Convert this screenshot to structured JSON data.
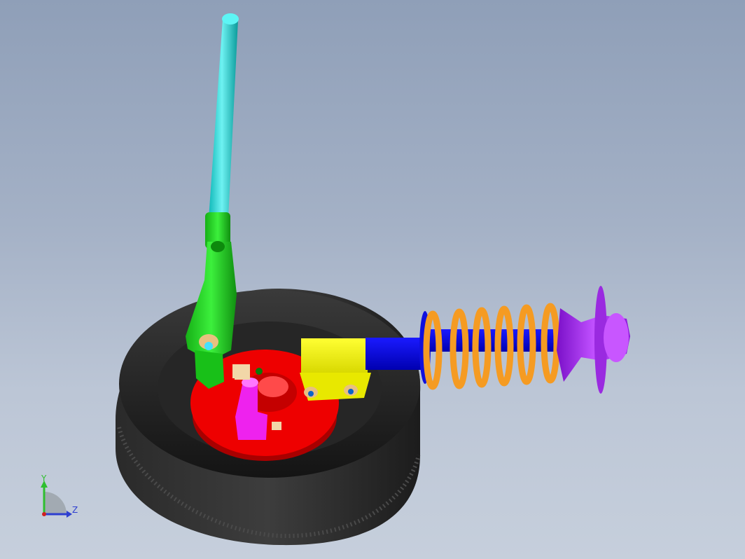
{
  "scene": {
    "background_top": "#8f9fb8",
    "background_bottom": "#c6cfdc",
    "parts": [
      {
        "name": "tire",
        "color": "#2a2a2a"
      },
      {
        "name": "brake-disc",
        "color": "#ee0000"
      },
      {
        "name": "steering-rod",
        "color": "#18d6d6"
      },
      {
        "name": "steering-knuckle",
        "color": "#1fd11f"
      },
      {
        "name": "strut-clamp",
        "color": "#f2f200"
      },
      {
        "name": "damper",
        "color": "#0000ee"
      },
      {
        "name": "coil-spring",
        "color": "#f59b22"
      },
      {
        "name": "top-mount",
        "color": "#a020f0"
      },
      {
        "name": "tie-rod-end",
        "color": "#ee22ee"
      }
    ]
  },
  "triad": {
    "y_label": "Y",
    "z_label": "Z",
    "y_color": "#2fbf2f",
    "z_color": "#2e3fd0"
  }
}
